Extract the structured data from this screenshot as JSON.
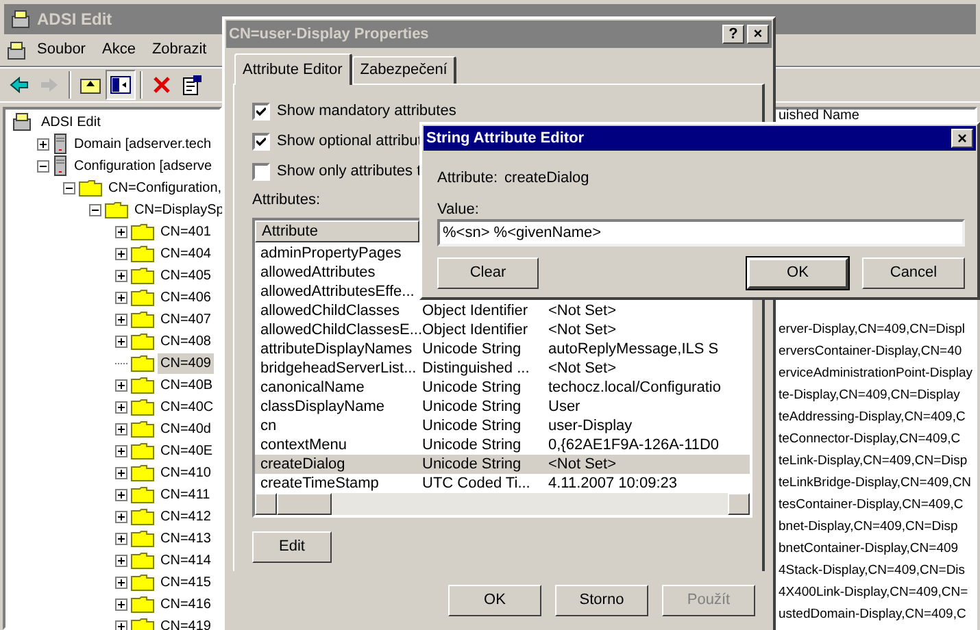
{
  "main_window": {
    "title": "ADSI Edit",
    "menu": [
      "Soubor",
      "Akce",
      "Zobrazit"
    ],
    "toolbar": [
      {
        "kind": "back",
        "disabled": false
      },
      {
        "kind": "forward",
        "disabled": true
      },
      {
        "kind": "sep"
      },
      {
        "kind": "up",
        "disabled": false
      },
      {
        "kind": "pane",
        "disabled": false,
        "pressed": true
      },
      {
        "kind": "sep"
      },
      {
        "kind": "delete",
        "disabled": false
      },
      {
        "kind": "properties",
        "disabled": false
      }
    ],
    "tree": [
      {
        "label": "ADSI Edit",
        "kind": "root",
        "selected": false,
        "children": [
          {
            "label": "Domain [adserver.tech",
            "kind": "server",
            "expanded": false,
            "selected": false
          },
          {
            "label": "Configuration [adserve",
            "kind": "server",
            "expanded": true,
            "selected": false,
            "children": [
              {
                "label": "CN=Configuration,",
                "kind": "folder",
                "expanded": true,
                "selected": false,
                "children": [
                  {
                    "label": "CN=DisplaySp",
                    "kind": "folder",
                    "expanded": true,
                    "selected": false,
                    "children": [
                      {
                        "label": "CN=401",
                        "kind": "folder",
                        "expanded": false,
                        "selected": false
                      },
                      {
                        "label": "CN=404",
                        "kind": "folder",
                        "expanded": false,
                        "selected": false
                      },
                      {
                        "label": "CN=405",
                        "kind": "folder",
                        "expanded": false,
                        "selected": false
                      },
                      {
                        "label": "CN=406",
                        "kind": "folder",
                        "expanded": false,
                        "selected": false
                      },
                      {
                        "label": "CN=407",
                        "kind": "folder",
                        "expanded": false,
                        "selected": false
                      },
                      {
                        "label": "CN=408",
                        "kind": "folder",
                        "expanded": false,
                        "selected": false
                      },
                      {
                        "label": "CN=409",
                        "kind": "leaf",
                        "selected": true
                      },
                      {
                        "label": "CN=40B",
                        "kind": "folder",
                        "expanded": false,
                        "selected": false
                      },
                      {
                        "label": "CN=40C",
                        "kind": "folder",
                        "expanded": false,
                        "selected": false
                      },
                      {
                        "label": "CN=40d",
                        "kind": "folder",
                        "expanded": false,
                        "selected": false
                      },
                      {
                        "label": "CN=40E",
                        "kind": "folder",
                        "expanded": false,
                        "selected": false
                      },
                      {
                        "label": "CN=410",
                        "kind": "folder",
                        "expanded": false,
                        "selected": false
                      },
                      {
                        "label": "CN=411",
                        "kind": "folder",
                        "expanded": false,
                        "selected": false
                      },
                      {
                        "label": "CN=412",
                        "kind": "folder",
                        "expanded": false,
                        "selected": false
                      },
                      {
                        "label": "CN=413",
                        "kind": "folder",
                        "expanded": false,
                        "selected": false
                      },
                      {
                        "label": "CN=414",
                        "kind": "folder",
                        "expanded": false,
                        "selected": false
                      },
                      {
                        "label": "CN=415",
                        "kind": "folder",
                        "expanded": false,
                        "selected": false
                      },
                      {
                        "label": "CN=416",
                        "kind": "folder",
                        "expanded": false,
                        "selected": false
                      },
                      {
                        "label": "CN=419",
                        "kind": "folder",
                        "expanded": false,
                        "selected": false
                      }
                    ]
                  }
                ]
              }
            ]
          }
        ]
      }
    ],
    "list_header": "uished Name",
    "list_rows": [
      "erver-Display,CN=409,CN=Displ",
      "erversContainer-Display,CN=40",
      "erviceAdministrationPoint-Display",
      "te-Display,CN=409,CN=Display",
      "teAddressing-Display,CN=409,C",
      "teConnector-Display,CN=409,C",
      "teLink-Display,CN=409,CN=Disp",
      "teLinkBridge-Display,CN=409,CN",
      "tesContainer-Display,CN=409,C",
      "bnet-Display,CN=409,CN=Disp",
      "bnetContainer-Display,CN=409",
      "4Stack-Display,CN=409,CN=Dis",
      "4X400Link-Display,CN=409,CN=",
      "ustedDomain-Display,CN=409,C"
    ]
  },
  "properties_dialog": {
    "title": "CN=user-Display Properties",
    "help": "?",
    "close": "×",
    "tabs": [
      {
        "label": "Attribute Editor",
        "selected": true
      },
      {
        "label": "Zabezpečení",
        "selected": false
      }
    ],
    "checkboxes": [
      {
        "label": "Show mandatory attributes",
        "checked": true
      },
      {
        "label": "Show optional attribut",
        "checked": true
      },
      {
        "label": "Show only attributes t",
        "checked": false
      }
    ],
    "attributes_label": "Attributes:",
    "columns": [
      "Attribute"
    ],
    "rows": [
      {
        "attribute": "adminPropertyPages",
        "selected": false
      },
      {
        "attribute": "allowedAttributes",
        "selected": false
      },
      {
        "attribute": "allowedAttributesEffe...",
        "selected": false
      },
      {
        "attribute": "allowedChildClasses",
        "syntax": "Object Identifier",
        "value": "<Not Set>",
        "selected": false
      },
      {
        "attribute": "allowedChildClassesE...",
        "syntax": "Object Identifier",
        "value": "<Not Set>",
        "selected": false
      },
      {
        "attribute": "attributeDisplayNames",
        "syntax": "Unicode String",
        "value": "autoReplyMessage,ILS S",
        "selected": false
      },
      {
        "attribute": "bridgeheadServerList...",
        "syntax": "Distinguished ...",
        "value": "<Not Set>",
        "selected": false
      },
      {
        "attribute": "canonicalName",
        "syntax": "Unicode String",
        "value": "techocz.local/Configuratio",
        "selected": false
      },
      {
        "attribute": "classDisplayName",
        "syntax": "Unicode String",
        "value": "User",
        "selected": false
      },
      {
        "attribute": "cn",
        "syntax": "Unicode String",
        "value": "user-Display",
        "selected": false
      },
      {
        "attribute": "contextMenu",
        "syntax": "Unicode String",
        "value": "0,{62AE1F9A-126A-11D0",
        "selected": false
      },
      {
        "attribute": "createDialog",
        "syntax": "Unicode String",
        "value": "<Not Set>",
        "selected": true
      },
      {
        "attribute": "createTimeStamp",
        "syntax": "UTC Coded Ti...",
        "value": "4.11.2007 10:09:23",
        "selected": false
      }
    ],
    "edit_button": "Edit",
    "buttons": [
      {
        "label": "OK",
        "disabled": false
      },
      {
        "label": "Storno",
        "disabled": false
      },
      {
        "label": "Použít",
        "disabled": true
      }
    ]
  },
  "string_editor": {
    "title": "String Attribute Editor",
    "close": "×",
    "attribute_label": "Attribute:",
    "attribute_name": "createDialog",
    "value_label": "Value:",
    "value": "%<sn> %<givenName>",
    "clear_button": "Clear",
    "ok_button": "OK",
    "cancel_button": "Cancel"
  }
}
